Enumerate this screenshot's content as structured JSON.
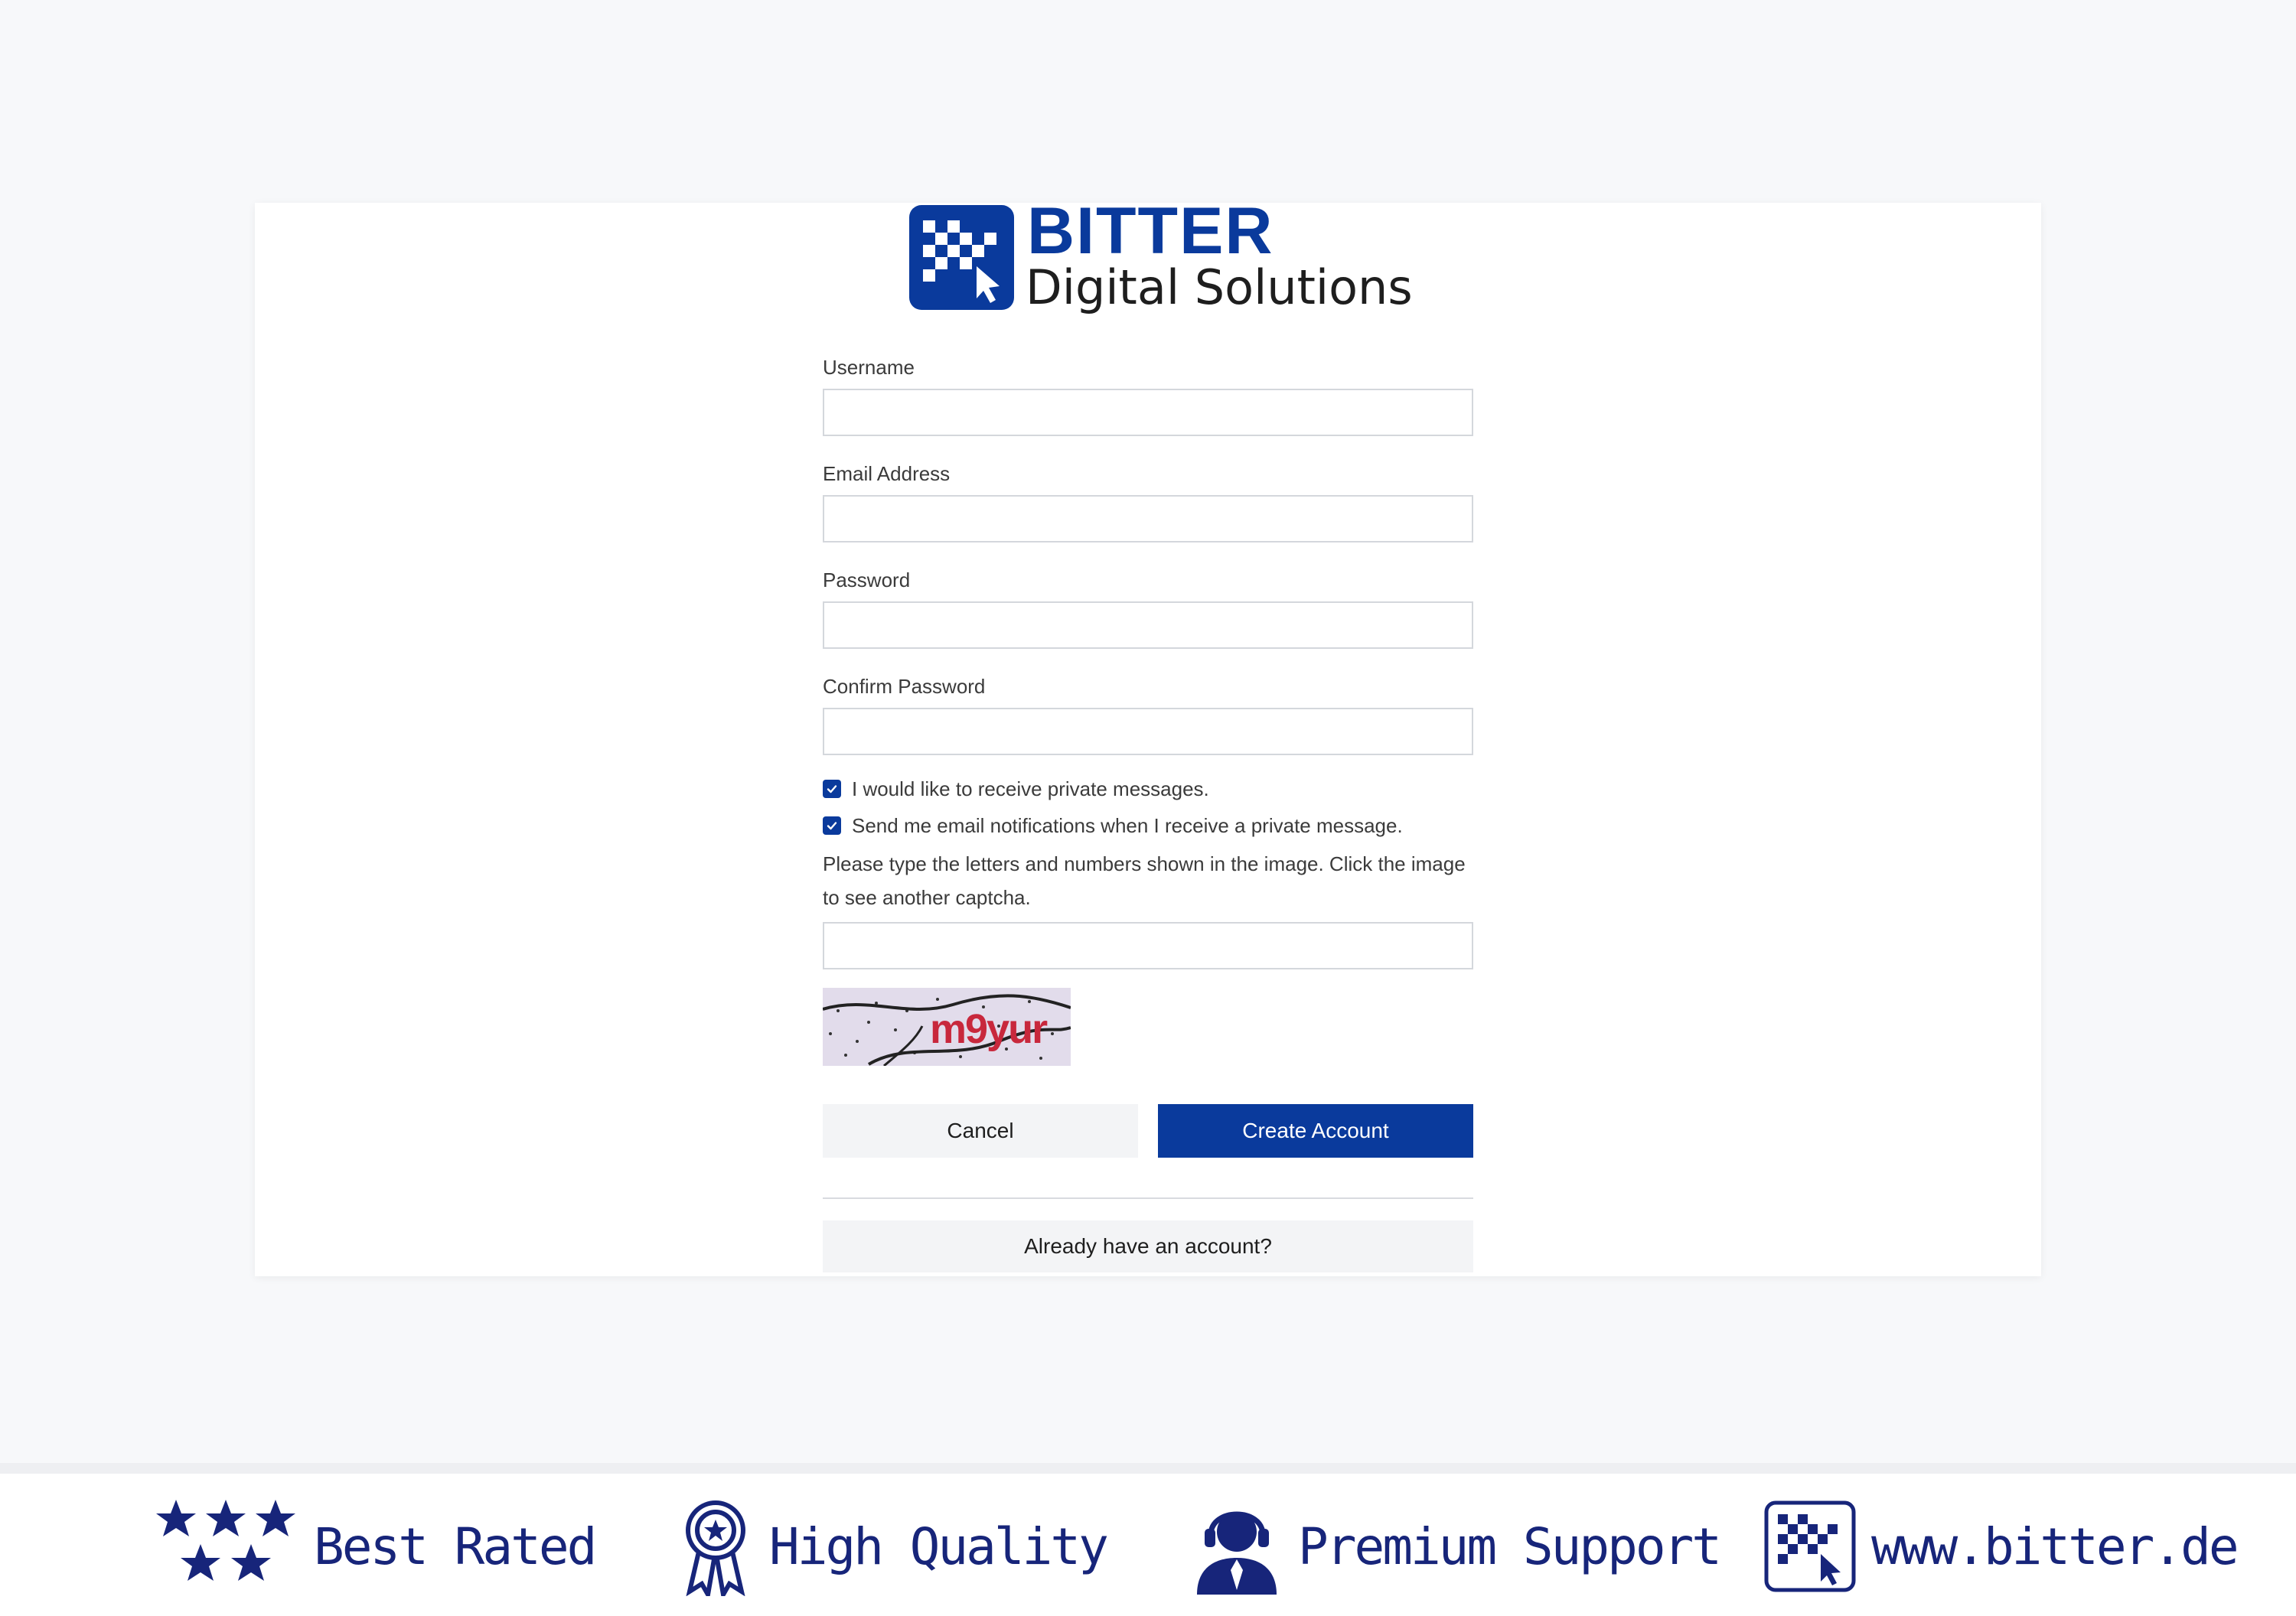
{
  "brand": {
    "name": "BITTER",
    "tagline": "Digital Solutions",
    "color": "#0a3a9c"
  },
  "form": {
    "username_label": "Username",
    "username_value": "",
    "email_label": "Email Address",
    "email_value": "",
    "password_label": "Password",
    "password_value": "",
    "confirm_label": "Confirm Password",
    "confirm_value": "",
    "checkboxes": [
      {
        "label": "I would like to receive private messages.",
        "checked": true
      },
      {
        "label": "Send me email notifications when I receive a private message.",
        "checked": true
      }
    ],
    "captcha_hint": "Please type the letters and numbers shown in the image. Click the image to see another captcha.",
    "captcha_value": "",
    "captcha_text": "m9yur",
    "cancel_label": "Cancel",
    "create_label": "Create Account",
    "login_label": "Already have an account?"
  },
  "footer": {
    "badges": [
      {
        "label": "Best Rated",
        "icon": "stars-icon"
      },
      {
        "label": "High Quality",
        "icon": "award-ribbon-icon"
      },
      {
        "label": "Premium Support",
        "icon": "support-agent-icon"
      },
      {
        "label": "www.bitter.de",
        "icon": "bitter-logo-icon"
      }
    ],
    "color": "#17257a"
  }
}
